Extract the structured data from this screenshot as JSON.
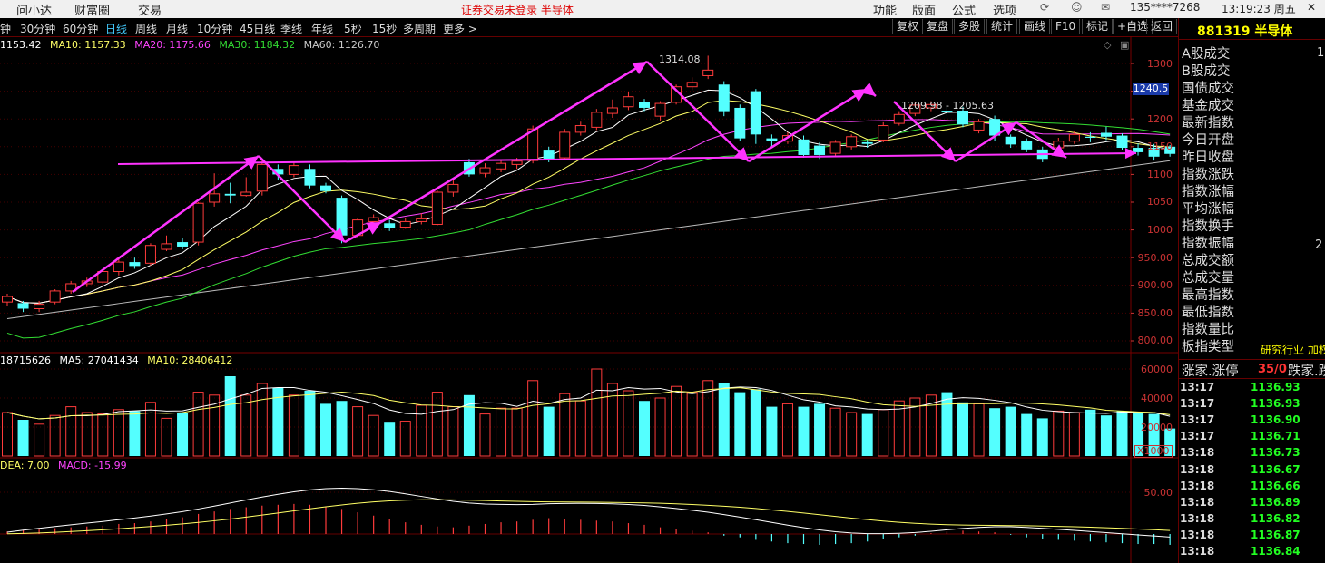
{
  "topbar": {
    "items": [
      "问小达",
      "财富圈",
      "交易"
    ],
    "notice": "证券交易未登录  半导体",
    "right_items": [
      "功能",
      "版面",
      "公式",
      "选项"
    ],
    "phone": "135****7268",
    "time": "13:19:23 周五"
  },
  "toolbar": {
    "periods": [
      "钟",
      "30分钟",
      "60分钟",
      "日线",
      "周线",
      "月线",
      "10分钟",
      "45日线",
      "季线",
      "年线",
      "5秒",
      "15秒",
      "多周期",
      "更多 >"
    ],
    "active_period": "日线",
    "buttons": [
      "复权",
      "复盘",
      "多股",
      "统计",
      "画线",
      "F10",
      "标记",
      "+自选",
      "返回"
    ]
  },
  "colors": {
    "up": "#ff3b3b",
    "down": "#54ffff",
    "ma5": "#ffffff",
    "ma10": "#ffff66",
    "ma20": "#ff44ff",
    "ma30": "#33dd33",
    "ma60": "#bbbbbb",
    "drawing": "#ff33ff"
  },
  "price_panel": {
    "ma_labels": {
      "ma5": "1153.42",
      "ma10": "MA10: 1157.33",
      "ma20": "MA20: 1175.66",
      "ma30": "MA30: 1184.32",
      "ma60": "MA60: 1126.70"
    },
    "high_label": "1314.08",
    "range_label": "1209.98 - 1205.63",
    "current_tag": "1240.5",
    "y_ticks": [
      "1300",
      "1250",
      "1200",
      "1150",
      "1100",
      "1050",
      "1000",
      "950.00",
      "900.00",
      "850.00",
      "800.00"
    ]
  },
  "volume_panel": {
    "labels": {
      "vol": "18715626",
      "ma5": "MA5: 27041434",
      "ma10": "MA10: 28406412"
    },
    "y_ticks": [
      "60000",
      "40000",
      "20000"
    ],
    "unit": "X1000"
  },
  "macd_panel": {
    "labels": {
      "dea": "DEA: 7.00",
      "macd": "MACD: -15.99"
    },
    "y_ticks": [
      "50.00"
    ]
  },
  "right_panel": {
    "code": "881319",
    "name": "半导体",
    "fields": [
      "A股成交",
      "B股成交",
      "国债成交",
      "基金成交",
      "最新指数",
      "今日开盘",
      "昨日收盘",
      "指数涨跌",
      "指数涨幅",
      "平均涨幅",
      "指数换手",
      "指数振幅",
      "总成交额",
      "总成交量",
      "最高指数",
      "最低指数",
      "指数量比",
      "板指类型"
    ],
    "a_share_partial": "1",
    "amplitude_partial": "2",
    "board_type_value": "研究行业 加权",
    "up_stocks_label": "涨家.涨停",
    "up_stocks_value": "35/0",
    "down_stocks_label": "跌家.跌"
  },
  "ticks": [
    {
      "time": "13:17",
      "price": "1136.93"
    },
    {
      "time": "13:17",
      "price": "1136.93"
    },
    {
      "time": "13:17",
      "price": "1136.90"
    },
    {
      "time": "13:17",
      "price": "1136.71"
    },
    {
      "time": "13:18",
      "price": "1136.73"
    },
    {
      "time": "13:18",
      "price": "1136.67"
    },
    {
      "time": "13:18",
      "price": "1136.66"
    },
    {
      "time": "13:18",
      "price": "1136.89"
    },
    {
      "time": "13:18",
      "price": "1136.82"
    },
    {
      "time": "13:18",
      "price": "1136.87"
    },
    {
      "time": "13:18",
      "price": "1136.84"
    }
  ],
  "chart_data": {
    "type": "candlestick",
    "price_range": [
      790,
      1320
    ],
    "candles": [
      {
        "o": 870,
        "c": 880,
        "h": 885,
        "l": 862
      },
      {
        "o": 868,
        "c": 858,
        "h": 872,
        "l": 852
      },
      {
        "o": 858,
        "c": 866,
        "h": 872,
        "l": 852
      },
      {
        "o": 870,
        "c": 890,
        "h": 893,
        "l": 866
      },
      {
        "o": 890,
        "c": 903,
        "h": 908,
        "l": 885
      },
      {
        "o": 903,
        "c": 908,
        "h": 914,
        "l": 897
      },
      {
        "o": 906,
        "c": 925,
        "h": 930,
        "l": 902
      },
      {
        "o": 925,
        "c": 942,
        "h": 948,
        "l": 918
      },
      {
        "o": 942,
        "c": 935,
        "h": 950,
        "l": 930
      },
      {
        "o": 940,
        "c": 972,
        "h": 976,
        "l": 936
      },
      {
        "o": 965,
        "c": 975,
        "h": 990,
        "l": 962
      },
      {
        "o": 978,
        "c": 970,
        "h": 985,
        "l": 965
      },
      {
        "o": 978,
        "c": 1048,
        "h": 1050,
        "l": 972
      },
      {
        "o": 1050,
        "c": 1065,
        "h": 1102,
        "l": 1042
      },
      {
        "o": 1065,
        "c": 1062,
        "h": 1085,
        "l": 1048
      },
      {
        "o": 1062,
        "c": 1068,
        "h": 1095,
        "l": 1060
      },
      {
        "o": 1070,
        "c": 1118,
        "h": 1125,
        "l": 1062
      },
      {
        "o": 1110,
        "c": 1100,
        "h": 1118,
        "l": 1090
      },
      {
        "o": 1100,
        "c": 1116,
        "h": 1122,
        "l": 1095
      },
      {
        "o": 1110,
        "c": 1080,
        "h": 1118,
        "l": 1075
      },
      {
        "o": 1080,
        "c": 1070,
        "h": 1085,
        "l": 1066
      },
      {
        "o": 1058,
        "c": 990,
        "h": 1062,
        "l": 976
      },
      {
        "o": 990,
        "c": 1018,
        "h": 1022,
        "l": 985
      },
      {
        "o": 1015,
        "c": 1022,
        "h": 1028,
        "l": 1008
      },
      {
        "o": 1012,
        "c": 1003,
        "h": 1018,
        "l": 998
      },
      {
        "o": 1005,
        "c": 1015,
        "h": 1022,
        "l": 1002
      },
      {
        "o": 1015,
        "c": 1020,
        "h": 1030,
        "l": 1010
      },
      {
        "o": 1010,
        "c": 1068,
        "h": 1072,
        "l": 1008
      },
      {
        "o": 1068,
        "c": 1082,
        "h": 1090,
        "l": 1060
      },
      {
        "o": 1122,
        "c": 1100,
        "h": 1128,
        "l": 1096
      },
      {
        "o": 1102,
        "c": 1112,
        "h": 1120,
        "l": 1095
      },
      {
        "o": 1110,
        "c": 1120,
        "h": 1126,
        "l": 1104
      },
      {
        "o": 1118,
        "c": 1124,
        "h": 1130,
        "l": 1110
      },
      {
        "o": 1125,
        "c": 1182,
        "h": 1188,
        "l": 1120
      },
      {
        "o": 1143,
        "c": 1128,
        "h": 1150,
        "l": 1122
      },
      {
        "o": 1130,
        "c": 1176,
        "h": 1182,
        "l": 1126
      },
      {
        "o": 1176,
        "c": 1188,
        "h": 1195,
        "l": 1170
      },
      {
        "o": 1185,
        "c": 1212,
        "h": 1218,
        "l": 1180
      },
      {
        "o": 1210,
        "c": 1220,
        "h": 1235,
        "l": 1202
      },
      {
        "o": 1222,
        "c": 1240,
        "h": 1248,
        "l": 1216
      },
      {
        "o": 1230,
        "c": 1220,
        "h": 1236,
        "l": 1214
      },
      {
        "o": 1205,
        "c": 1228,
        "h": 1232,
        "l": 1196
      },
      {
        "o": 1230,
        "c": 1258,
        "h": 1262,
        "l": 1226
      },
      {
        "o": 1258,
        "c": 1266,
        "h": 1275,
        "l": 1252
      },
      {
        "o": 1278,
        "c": 1288,
        "h": 1314,
        "l": 1272
      },
      {
        "o": 1262,
        "c": 1214,
        "h": 1268,
        "l": 1205
      },
      {
        "o": 1220,
        "c": 1165,
        "h": 1226,
        "l": 1160
      },
      {
        "o": 1250,
        "c": 1172,
        "h": 1254,
        "l": 1155
      },
      {
        "o": 1165,
        "c": 1160,
        "h": 1172,
        "l": 1150
      },
      {
        "o": 1160,
        "c": 1170,
        "h": 1176,
        "l": 1155
      },
      {
        "o": 1163,
        "c": 1135,
        "h": 1170,
        "l": 1130
      },
      {
        "o": 1152,
        "c": 1135,
        "h": 1158,
        "l": 1128
      },
      {
        "o": 1138,
        "c": 1158,
        "h": 1162,
        "l": 1132
      },
      {
        "o": 1150,
        "c": 1168,
        "h": 1172,
        "l": 1145
      },
      {
        "o": 1158,
        "c": 1155,
        "h": 1162,
        "l": 1148
      },
      {
        "o": 1162,
        "c": 1188,
        "h": 1194,
        "l": 1158
      },
      {
        "o": 1192,
        "c": 1208,
        "h": 1214,
        "l": 1188
      },
      {
        "o": 1210,
        "c": 1225,
        "h": 1230,
        "l": 1205
      },
      {
        "o": 1220,
        "c": 1226,
        "h": 1232,
        "l": 1214
      },
      {
        "o": 1215,
        "c": 1212,
        "h": 1222,
        "l": 1206
      },
      {
        "o": 1215,
        "c": 1190,
        "h": 1222,
        "l": 1185
      },
      {
        "o": 1180,
        "c": 1195,
        "h": 1200,
        "l": 1174
      },
      {
        "o": 1200,
        "c": 1170,
        "h": 1206,
        "l": 1160
      },
      {
        "o": 1168,
        "c": 1154,
        "h": 1172,
        "l": 1148
      },
      {
        "o": 1160,
        "c": 1145,
        "h": 1165,
        "l": 1140
      },
      {
        "o": 1145,
        "c": 1128,
        "h": 1150,
        "l": 1122
      },
      {
        "o": 1148,
        "c": 1160,
        "h": 1166,
        "l": 1142
      },
      {
        "o": 1160,
        "c": 1172,
        "h": 1178,
        "l": 1155
      },
      {
        "o": 1168,
        "c": 1166,
        "h": 1176,
        "l": 1158
      },
      {
        "o": 1175,
        "c": 1168,
        "h": 1186,
        "l": 1162
      },
      {
        "o": 1170,
        "c": 1148,
        "h": 1174,
        "l": 1144
      },
      {
        "o": 1148,
        "c": 1140,
        "h": 1156,
        "l": 1134
      },
      {
        "o": 1148,
        "c": 1132,
        "h": 1155,
        "l": 1125
      },
      {
        "o": 1150,
        "c": 1137,
        "h": 1153,
        "l": 1132
      }
    ],
    "volumes": [
      30,
      25,
      22,
      28,
      34,
      30,
      29,
      32,
      31,
      37,
      26,
      30,
      44,
      42,
      55,
      42,
      50,
      47,
      42,
      45,
      36,
      38,
      34,
      28,
      23,
      24,
      35,
      44,
      34,
      42,
      29,
      33,
      33,
      52,
      34,
      43,
      38,
      60,
      50,
      45,
      38,
      40,
      48,
      44,
      52,
      50,
      44,
      46,
      34,
      36,
      34,
      36,
      33,
      30,
      29,
      32,
      38,
      40,
      42,
      44,
      37,
      36,
      33,
      34,
      29,
      26,
      31,
      30,
      32,
      28,
      31,
      30,
      29,
      19
    ],
    "macd_hist": [
      3,
      5,
      6,
      7,
      8,
      9,
      10,
      12,
      13,
      15,
      18,
      20,
      24,
      27,
      30,
      32,
      34,
      35,
      36,
      35,
      33,
      30,
      26,
      22,
      18,
      14,
      11,
      9,
      8,
      10,
      12,
      14,
      15,
      17,
      19,
      18,
      17,
      16,
      15,
      13,
      11,
      8,
      6,
      4,
      2,
      -2,
      -4,
      -7,
      -9,
      -11,
      -12,
      -13,
      -12,
      -11,
      -9,
      -6,
      -4,
      -2,
      1,
      3,
      4,
      3,
      2,
      -1,
      -4,
      -6,
      -7,
      -8,
      -9,
      -10,
      -11,
      -12,
      -12,
      -13
    ]
  }
}
